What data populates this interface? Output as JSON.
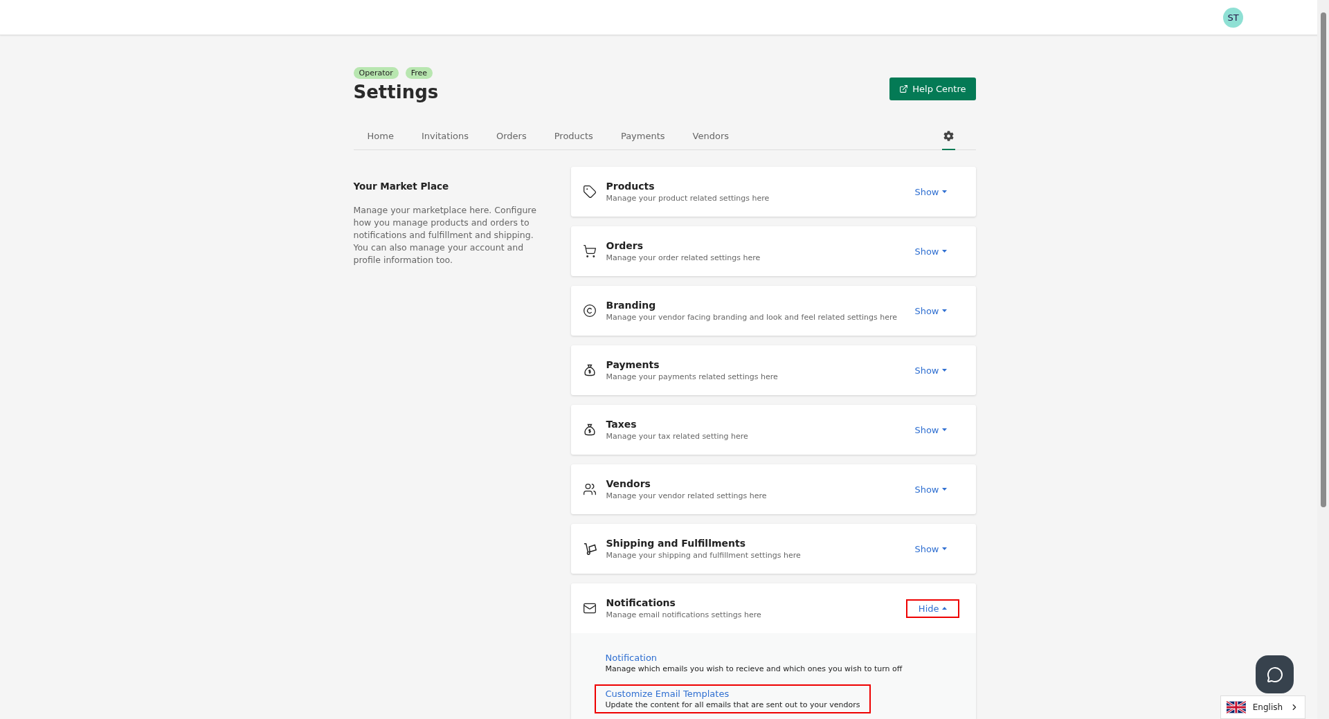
{
  "header": {
    "avatar": "ST"
  },
  "badges": [
    "Operator",
    "Free"
  ],
  "title": "Settings",
  "help_button": "Help Centre",
  "tabs": [
    {
      "label": "Home",
      "selected": false
    },
    {
      "label": "Invitations",
      "selected": false
    },
    {
      "label": "Orders",
      "selected": false
    },
    {
      "label": "Products",
      "selected": false
    },
    {
      "label": "Payments",
      "selected": false
    },
    {
      "label": "Vendors",
      "selected": false
    }
  ],
  "settings_tab": {
    "selected": true
  },
  "intro": {
    "heading": "Your Market Place",
    "text": "Manage your marketplace here. Configure how you manage products and orders to notifications and fulfillment and shipping. You can also manage your account and profile information too."
  },
  "sections": [
    {
      "kind": "tag",
      "title": "Products",
      "subtitle": "Manage your product related settings here",
      "toggle": "Show",
      "expanded": false,
      "highlighted": false
    },
    {
      "kind": "cart",
      "title": "Orders",
      "subtitle": "Manage your order related settings here",
      "toggle": "Show",
      "expanded": false,
      "highlighted": false
    },
    {
      "kind": "copyright",
      "title": "Branding",
      "subtitle": "Manage your vendor facing branding and look and feel related settings here",
      "toggle": "Show",
      "expanded": false,
      "highlighted": false
    },
    {
      "kind": "moneybag",
      "title": "Payments",
      "subtitle": "Manage your payments related settings here",
      "toggle": "Show",
      "expanded": false,
      "highlighted": false
    },
    {
      "kind": "moneybag",
      "title": "Taxes",
      "subtitle": "Manage your tax related setting here",
      "toggle": "Show",
      "expanded": false,
      "highlighted": false
    },
    {
      "kind": "users",
      "title": "Vendors",
      "subtitle": "Manage your vendor related settings here",
      "toggle": "Show",
      "expanded": false,
      "highlighted": false
    },
    {
      "kind": "handtruck",
      "title": "Shipping and Fulfillments",
      "subtitle": "Manage your shipping and fulfillment settings here",
      "toggle": "Show",
      "expanded": false,
      "highlighted": false
    },
    {
      "kind": "mail",
      "title": "Notifications",
      "subtitle": "Manage email notifications settings here",
      "toggle": "Hide",
      "expanded": true,
      "highlighted": true,
      "links": [
        {
          "title": "Notification",
          "description": "Manage which emails you wish to recieve and which ones you wish to turn off",
          "highlighted": false
        },
        {
          "title": "Customize Email Templates",
          "description": "Update the content for all emails that are sent out to your vendors",
          "highlighted": true
        }
      ]
    }
  ],
  "language": "English"
}
